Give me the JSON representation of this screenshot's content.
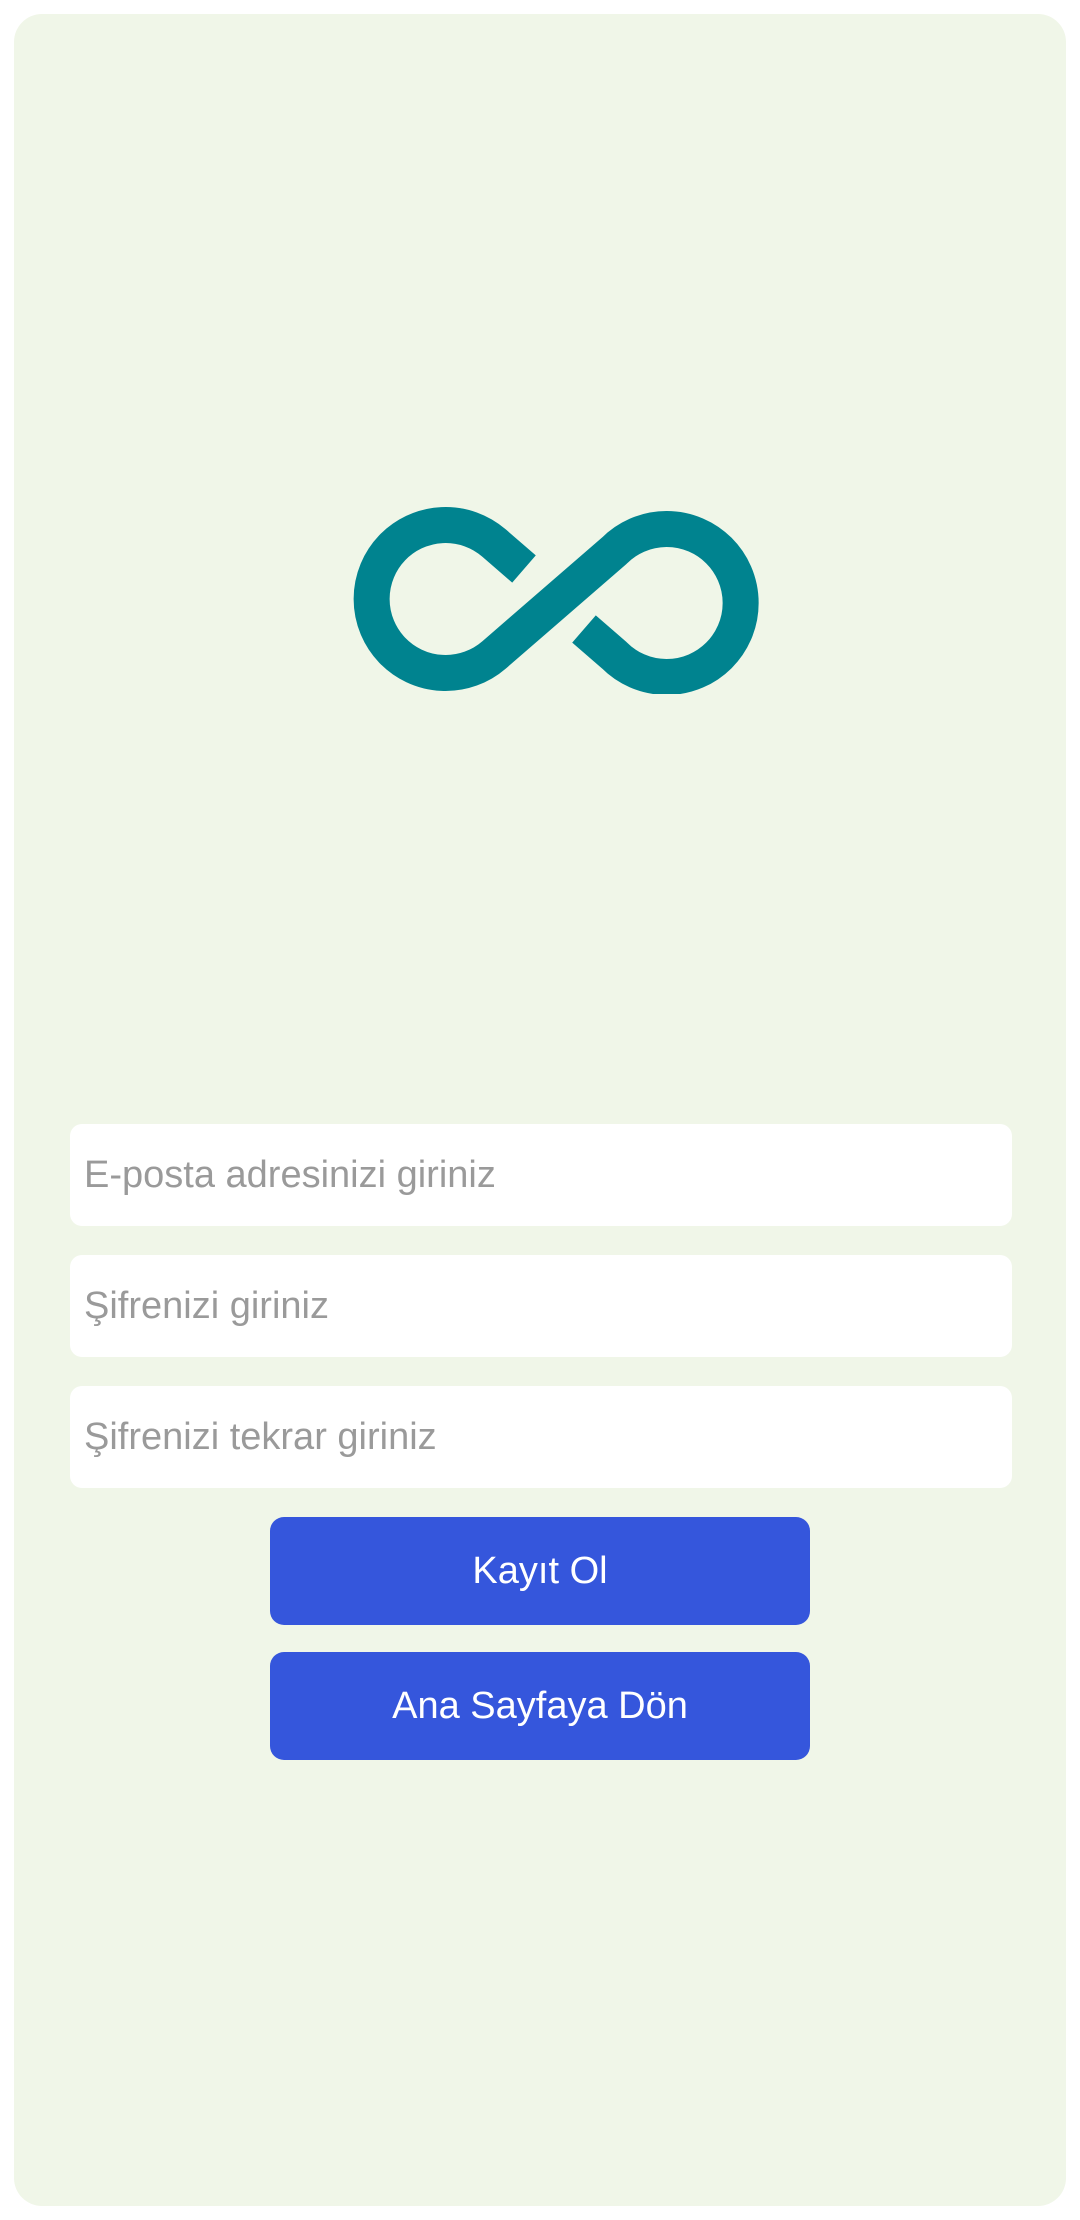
{
  "colors": {
    "background": "#f0f6e8",
    "logo": "#00838f",
    "button": "#3556dc",
    "button_text": "#ffffff",
    "placeholder": "#9a9a9a"
  },
  "logo": {
    "icon": "infinity-icon"
  },
  "form": {
    "email_placeholder": "E-posta adresinizi giriniz",
    "password_placeholder": "Şifrenizi giriniz",
    "password_repeat_placeholder": "Şifrenizi tekrar giriniz",
    "email_value": "",
    "password_value": "",
    "password_repeat_value": ""
  },
  "buttons": {
    "register_label": "Kayıt Ol",
    "home_label": "Ana Sayfaya Dön"
  }
}
